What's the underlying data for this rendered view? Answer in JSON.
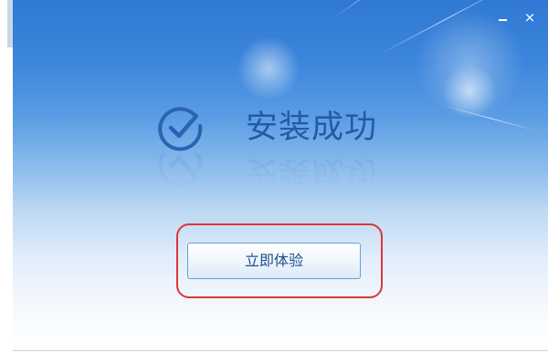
{
  "window": {
    "minimize_label": "_",
    "close_label": "×"
  },
  "status": {
    "icon": "check-circle-icon",
    "title": "安装成功"
  },
  "action": {
    "primary_label": "立即体验"
  },
  "colors": {
    "header_blue": "#2f79d4",
    "title_text": "#245aa5",
    "highlight_ring": "#d9383a",
    "button_border": "#6a9fd2"
  }
}
